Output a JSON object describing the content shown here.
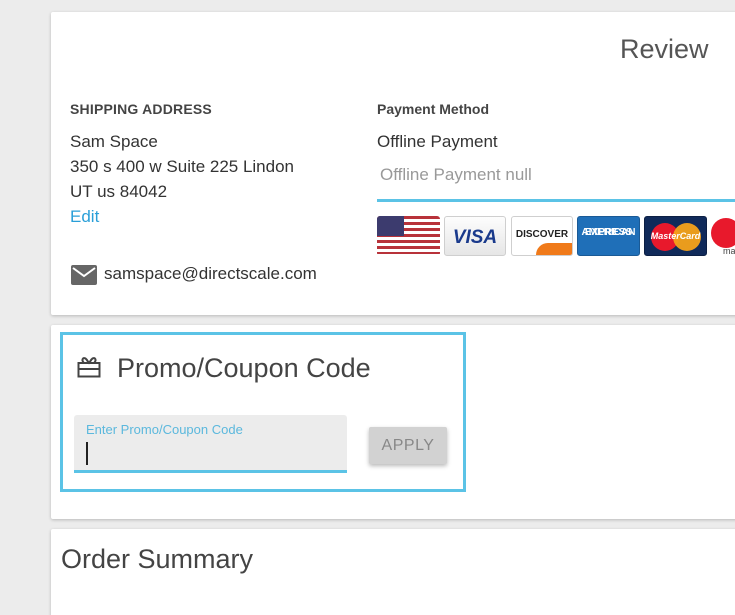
{
  "review": {
    "title": "Review",
    "shipping": {
      "heading": "SHIPPING ADDRESS",
      "name": "Sam Space",
      "street": "350 s 400 w Suite 225 Lindon",
      "city_line": "UT us 84042",
      "edit_label": "Edit",
      "email": "samspace@directscale.com"
    },
    "payment": {
      "heading": "Payment Method",
      "method": "Offline Payment",
      "selected_option": "Offline Payment null",
      "cards": [
        "US flag",
        "VISA",
        "DISCOVER",
        "AMERICAN EXPRESS",
        "MasterCard",
        "maestro"
      ],
      "visa_label": "VISA",
      "discover_label": "DISCOVER",
      "amex_label_1": "AMERICAN",
      "amex_label_2": "EXPRESS",
      "master_label": "MasterCard",
      "maestro_label": "mae"
    }
  },
  "promo": {
    "title": "Promo/Coupon Code",
    "input_label": "Enter Promo/Coupon Code",
    "input_value": "",
    "apply_label": "APPLY"
  },
  "summary": {
    "title": "Order Summary"
  },
  "colors": {
    "accent": "#5bc3e6",
    "link": "#2a9fd8",
    "background": "#ececec"
  }
}
